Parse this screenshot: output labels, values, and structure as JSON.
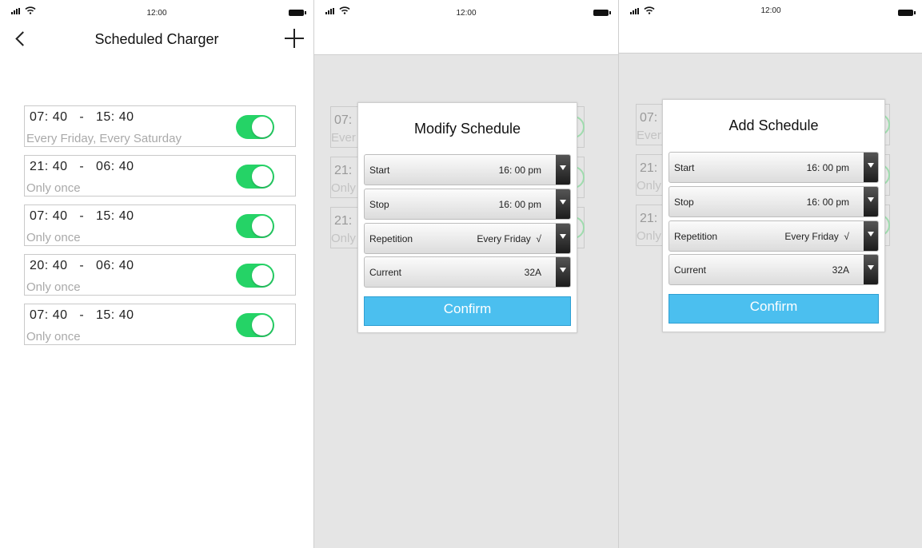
{
  "status_bar": {
    "time": "12:00"
  },
  "list_screen": {
    "title": "Scheduled Charger",
    "schedules": [
      {
        "start": "07: 40",
        "separator": "-",
        "stop": "15: 40",
        "repeat": "Every Friday, Every Saturday",
        "enabled": true
      },
      {
        "start": "21: 40",
        "separator": "-",
        "stop": "06: 40",
        "repeat": "Only once",
        "enabled": true
      },
      {
        "start": "07: 40",
        "separator": "-",
        "stop": "15: 40",
        "repeat": "Only once",
        "enabled": true
      },
      {
        "start": "20: 40",
        "separator": "-",
        "stop": "06: 40",
        "repeat": "Only once",
        "enabled": true
      },
      {
        "start": "07: 40",
        "separator": "-",
        "stop": "15: 40",
        "repeat": "Only once",
        "enabled": true
      }
    ]
  },
  "background_cards": [
    {
      "time": "07:",
      "repeat": "Ever"
    },
    {
      "time": "21:",
      "repeat": "Only"
    },
    {
      "time": "21:",
      "repeat": "Only"
    }
  ],
  "modify_dialog": {
    "title": "Modify Schedule",
    "fields": [
      {
        "label": "Start",
        "value": "16: 00 pm"
      },
      {
        "label": "Stop",
        "value": "16: 00 pm"
      },
      {
        "label": "Repetition",
        "value": "Every Friday  √"
      },
      {
        "label": "Current",
        "value": "32A"
      }
    ],
    "confirm_label": "Confirm"
  },
  "add_dialog": {
    "title": "Add Schedule",
    "fields": [
      {
        "label": "Start",
        "value": "16: 00 pm"
      },
      {
        "label": "Stop",
        "value": "16: 00 pm"
      },
      {
        "label": "Repetition",
        "value": "Every Friday  √"
      },
      {
        "label": "Current",
        "value": "32A"
      }
    ],
    "confirm_label": "Confirm"
  },
  "colors": {
    "toggle_on": "#25d366",
    "confirm": "#4bbfef",
    "overlay": "#e5e5e5"
  },
  "icons": {
    "back": "back-chevron-icon",
    "add": "plus-icon",
    "dropdown": "dropdown-arrow-icon"
  }
}
